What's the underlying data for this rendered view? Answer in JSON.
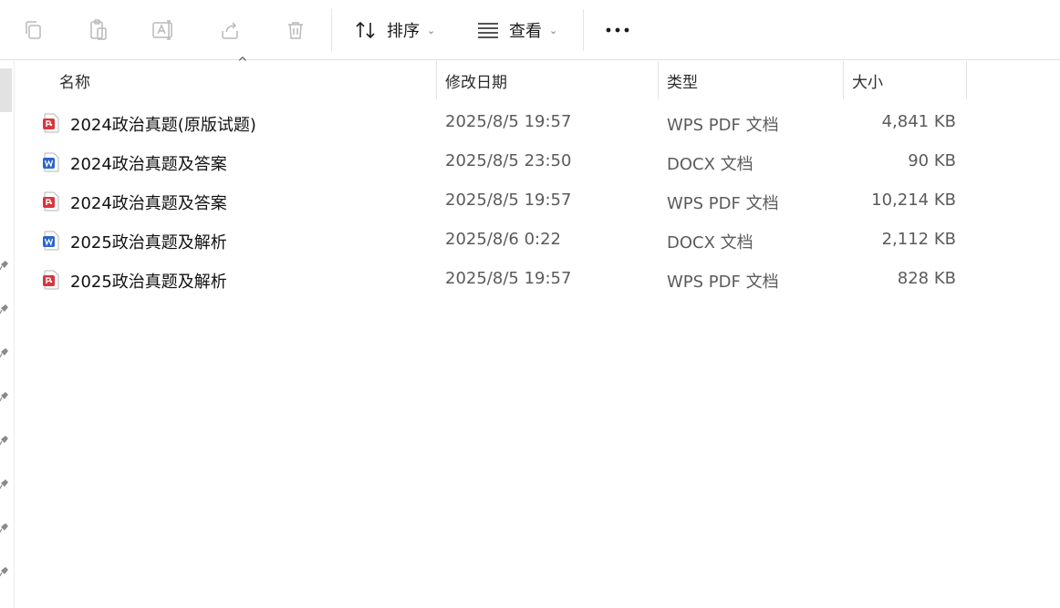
{
  "toolbar": {
    "buttons": [
      {
        "name": "copy-icon"
      },
      {
        "name": "paste-icon"
      },
      {
        "name": "rename-icon"
      },
      {
        "name": "share-icon"
      },
      {
        "name": "delete-icon"
      }
    ],
    "sort_label": "排序",
    "view_label": "查看",
    "more_icon": "more-icon"
  },
  "columns": {
    "name": "名称",
    "date": "修改日期",
    "type": "类型",
    "size": "大小",
    "sort_indicator": "^"
  },
  "files": [
    {
      "name": "2024政治真题(原版试题)",
      "date": "2025/8/5 19:57",
      "type": "WPS PDF 文档",
      "size": "4,841 KB",
      "icon": "pdf-icon"
    },
    {
      "name": "2024政治真题及答案",
      "date": "2025/8/5 23:50",
      "type": "DOCX 文档",
      "size": "90 KB",
      "icon": "word-icon"
    },
    {
      "name": "2024政治真题及答案",
      "date": "2025/8/5 19:57",
      "type": "WPS PDF 文档",
      "size": "10,214 KB",
      "icon": "pdf-icon"
    },
    {
      "name": "2025政治真题及解析",
      "date": "2025/8/6 0:22",
      "type": "DOCX 文档",
      "size": "2,112 KB",
      "icon": "word-icon"
    },
    {
      "name": "2025政治真题及解析",
      "date": "2025/8/5 19:57",
      "type": "WPS PDF 文档",
      "size": "828 KB",
      "icon": "pdf-icon"
    }
  ],
  "colors": {
    "pdf_red": "#d9363e",
    "word_blue": "#2b65c8",
    "disabled_icon": "#b9b9b9"
  }
}
